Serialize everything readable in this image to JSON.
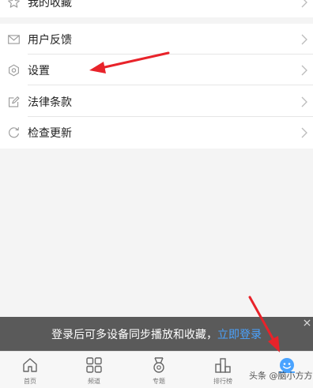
{
  "menu": {
    "favorites_label": "我的收藏",
    "items": [
      {
        "label": "用户反馈",
        "icon": "mail-icon"
      },
      {
        "label": "设置",
        "icon": "gear-icon"
      },
      {
        "label": "法律条款",
        "icon": "edit-icon"
      },
      {
        "label": "检查更新",
        "icon": "refresh-icon"
      }
    ]
  },
  "login_banner": {
    "text": "登录后可多设备同步播放和收藏，",
    "link": "立即登录"
  },
  "tabbar": {
    "items": [
      {
        "label": "首页",
        "icon": "home-icon"
      },
      {
        "label": "频道",
        "icon": "grid-icon"
      },
      {
        "label": "专题",
        "icon": "medal-icon"
      },
      {
        "label": "排行榜",
        "icon": "ranking-icon"
      },
      {
        "label": "",
        "icon": "profile-icon",
        "active": true
      }
    ]
  },
  "watermark": "头条 @脑小方方",
  "colors": {
    "accent": "#4aa3ff",
    "annotation_arrow": "#e8232a",
    "banner_bg": "#5a5a5a"
  }
}
